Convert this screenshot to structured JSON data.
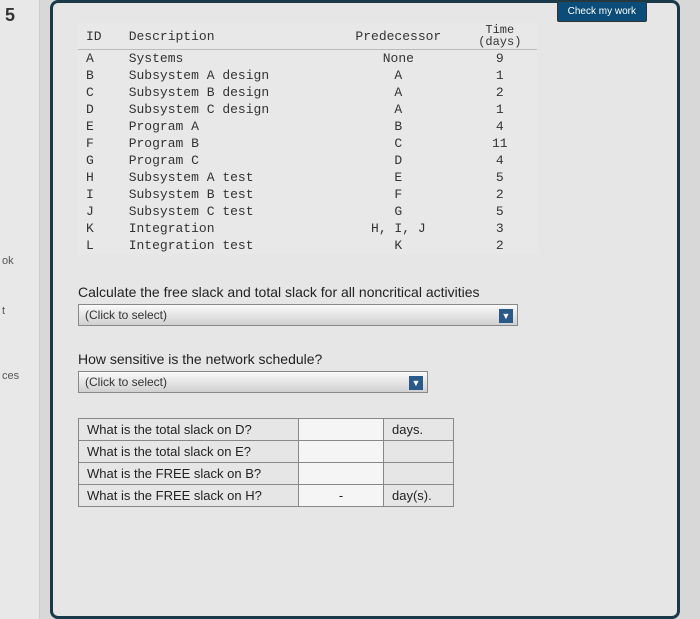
{
  "check_label": "Check my work",
  "left_labels": {
    "a": "ok",
    "b": "t",
    "c": "ces"
  },
  "table": {
    "headers": {
      "id": "ID",
      "desc": "Description",
      "pred": "Predecessor",
      "time_top": "Time",
      "time_bot": "(days)"
    },
    "rows": [
      {
        "id": "A",
        "desc": "Systems",
        "pred": "None",
        "time": "9"
      },
      {
        "id": "B",
        "desc": "Subsystem A design",
        "pred": "A",
        "time": "1"
      },
      {
        "id": "C",
        "desc": "Subsystem B design",
        "pred": "A",
        "time": "2"
      },
      {
        "id": "D",
        "desc": "Subsystem C design",
        "pred": "A",
        "time": "1"
      },
      {
        "id": "E",
        "desc": "Program A",
        "pred": "B",
        "time": "4"
      },
      {
        "id": "F",
        "desc": "Program B",
        "pred": "C",
        "time": "11"
      },
      {
        "id": "G",
        "desc": "Program C",
        "pred": "D",
        "time": "4"
      },
      {
        "id": "H",
        "desc": "Subsystem A test",
        "pred": "E",
        "time": "5"
      },
      {
        "id": "I",
        "desc": "Subsystem B test",
        "pred": "F",
        "time": "2"
      },
      {
        "id": "J",
        "desc": "Subsystem C test",
        "pred": "G",
        "time": "5"
      },
      {
        "id": "K",
        "desc": "Integration",
        "pred": "H, I, J",
        "time": "3"
      },
      {
        "id": "L",
        "desc": "Integration test",
        "pred": "K",
        "time": "2"
      }
    ]
  },
  "q1": "Calculate the free slack and total slack for all noncritical activities",
  "q2": "How sensitive is the network schedule?",
  "select_placeholder": "(Click to select)",
  "slack": {
    "r1": "What is the total slack on D?",
    "r2": "What is the total slack on E?",
    "r3": "What is the FREE slack on B?",
    "r4": "What is the FREE slack on H?",
    "u1": "days.",
    "u4": "day(s).",
    "v4": "-"
  }
}
